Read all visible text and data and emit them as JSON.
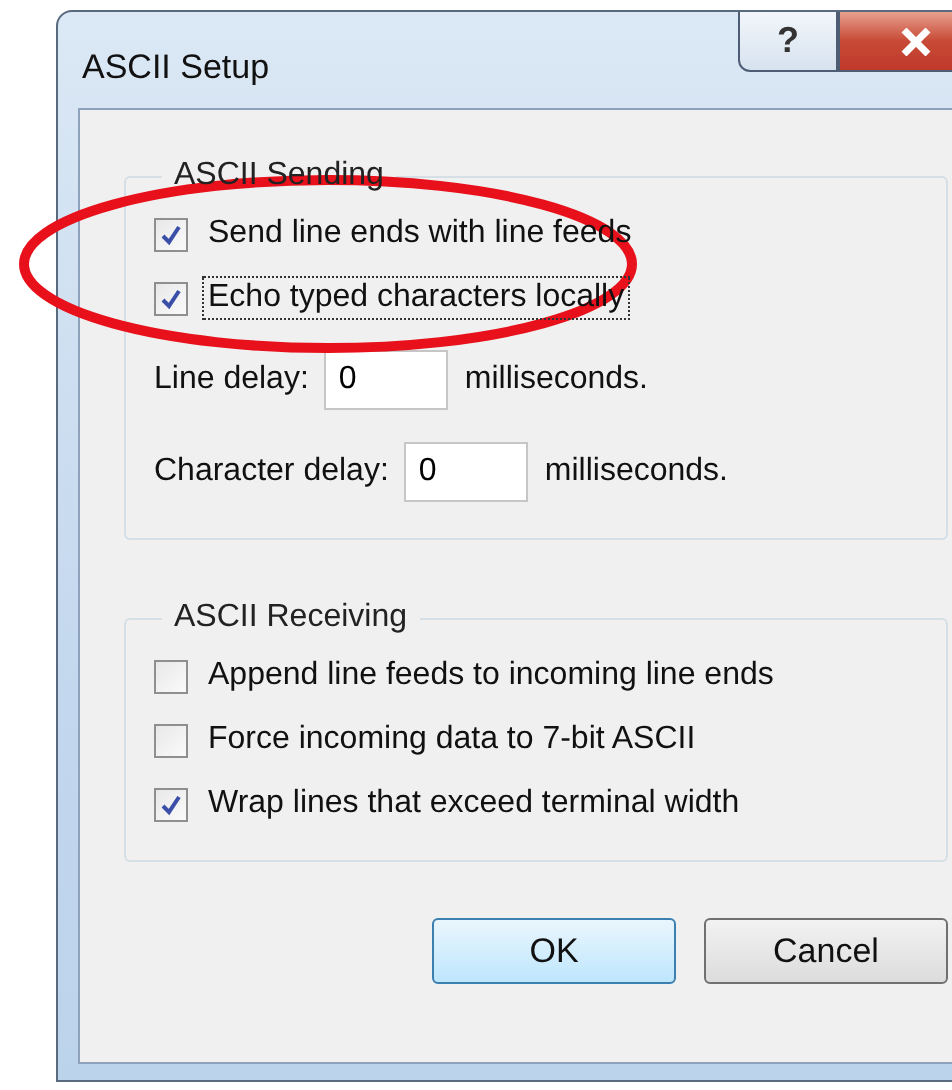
{
  "window": {
    "title": "ASCII Setup"
  },
  "title_buttons": [
    {
      "kind": "help",
      "label": "?"
    },
    {
      "kind": "close"
    }
  ],
  "sending": {
    "title": "ASCII Sending",
    "options": [
      {
        "label": "Send line ends with line feeds",
        "checked": true,
        "focused": false
      },
      {
        "label": "Echo typed characters locally",
        "checked": true,
        "focused": true
      }
    ],
    "fields": [
      {
        "label": "Line delay:",
        "value": "0",
        "unit": "milliseconds."
      },
      {
        "label": "Character delay:",
        "value": "0",
        "unit": "milliseconds."
      }
    ]
  },
  "receiving": {
    "title": "ASCII Receiving",
    "options": [
      {
        "label": "Append line feeds to incoming line ends",
        "checked": false,
        "focused": false
      },
      {
        "label": "Force incoming data to 7-bit ASCII",
        "checked": false,
        "focused": false
      },
      {
        "label": "Wrap lines that exceed terminal width",
        "checked": true,
        "focused": false
      }
    ]
  },
  "buttons": [
    {
      "label": "OK",
      "default": true
    },
    {
      "label": "Cancel",
      "default": false
    }
  ]
}
